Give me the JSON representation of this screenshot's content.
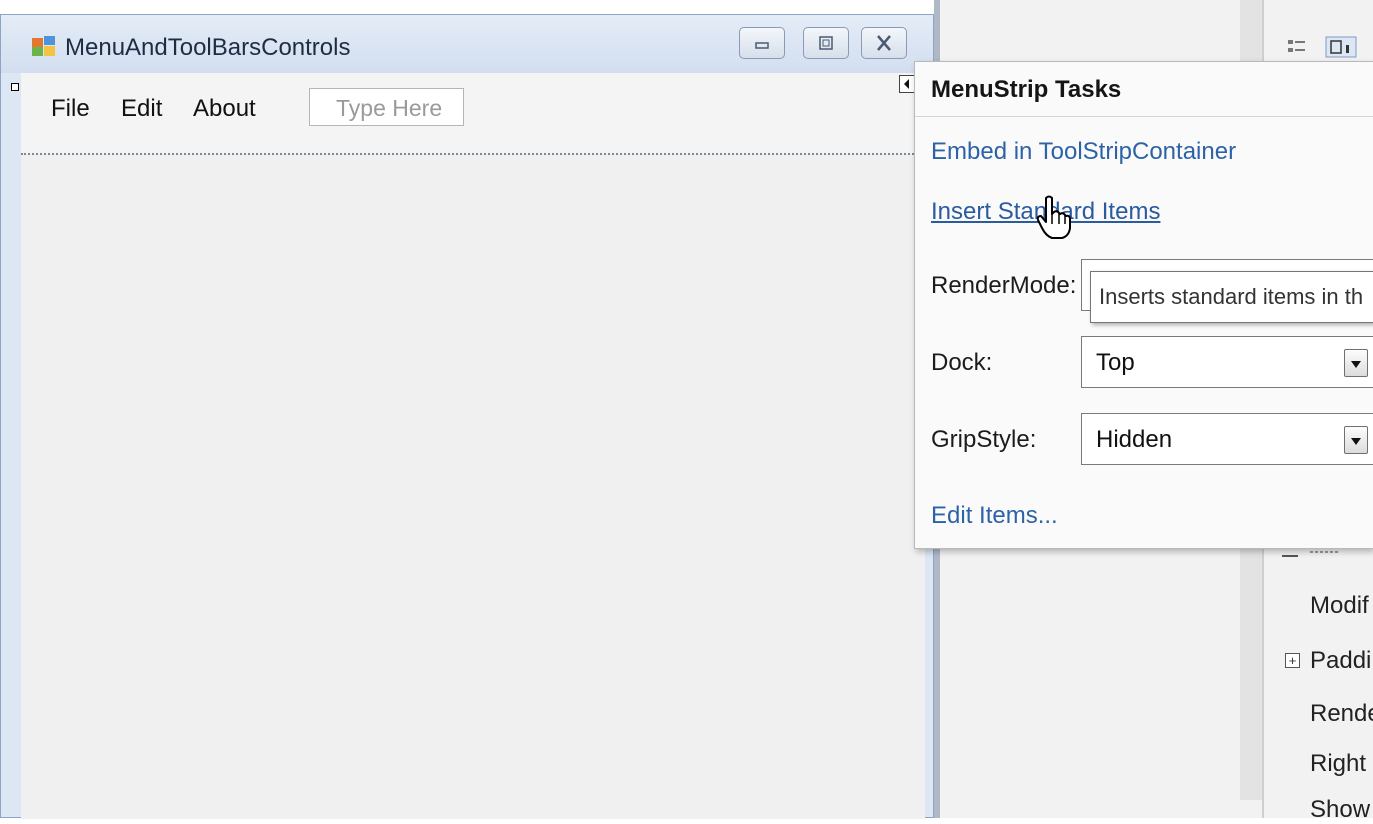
{
  "window": {
    "title": "MenuAndToolBarsControls"
  },
  "menustrip": {
    "items": [
      "File",
      "Edit",
      "About"
    ],
    "type_here_placeholder": "Type Here"
  },
  "tasks_panel": {
    "title": "MenuStrip Tasks",
    "embed_link": "Embed in ToolStripContainer",
    "insert_link": "Insert Standard Items",
    "rendermode_label": "RenderMode:",
    "rendermode_value": "",
    "dock_label": "Dock:",
    "dock_value": "Top",
    "gripstyle_label": "GripStyle:",
    "gripstyle_value": "Hidden",
    "edit_items_link": "Edit Items..."
  },
  "tooltip": {
    "text": "Inserts standard items in th"
  },
  "properties": {
    "rows": [
      "Modif",
      "Paddi",
      "Rende",
      "Right",
      "Show"
    ]
  },
  "colors": {
    "link": "#2d63a6",
    "title_bar": "#d2def0",
    "form_background": "#f0f0f0"
  }
}
